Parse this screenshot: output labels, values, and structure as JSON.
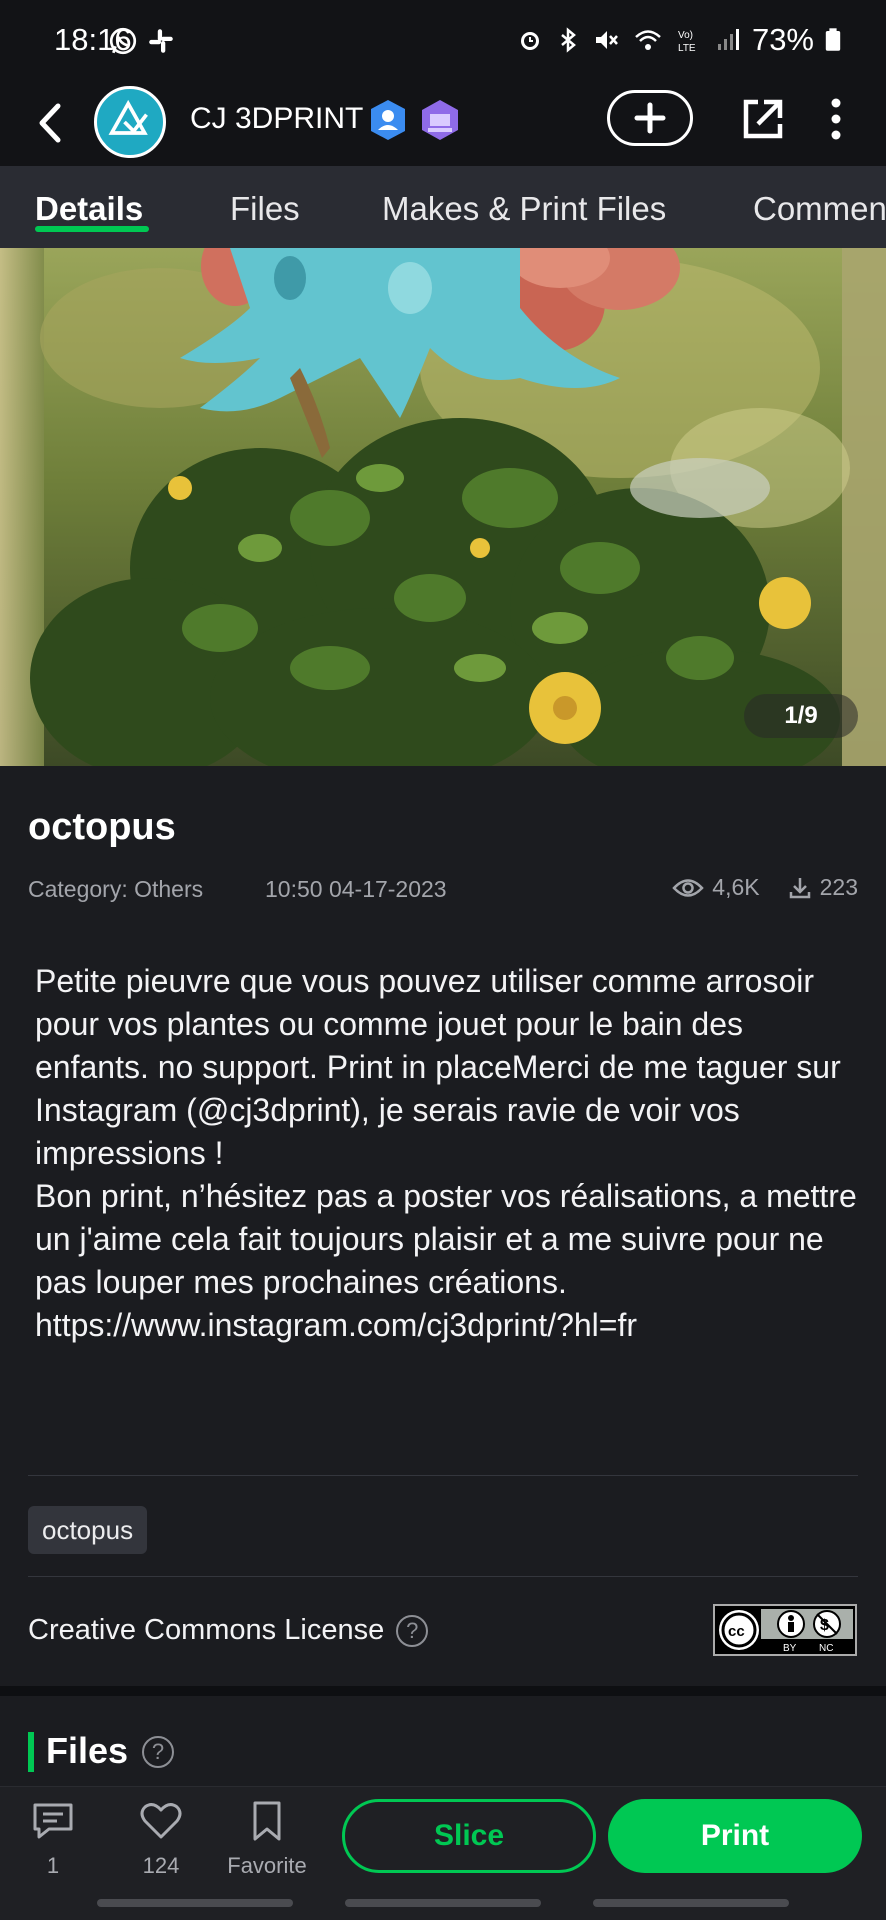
{
  "status_bar": {
    "time": "18:16",
    "battery": "73%",
    "icons_left": [
      "whatsapp-icon",
      "slack-icon"
    ],
    "icons_right": [
      "alarm-icon",
      "bluetooth-icon",
      "mute-icon",
      "wifi-icon",
      "volte-icon",
      "signal-icon",
      "battery-icon"
    ]
  },
  "header": {
    "author": "CJ 3DPRINT",
    "avatar_label": "3D PRINT"
  },
  "tabs": [
    "Details",
    "Files",
    "Makes & Print Files",
    "Commen"
  ],
  "gallery": {
    "counter": "1/9"
  },
  "model": {
    "title": "octopus",
    "category": "Category: Others",
    "timestamp": "10:50 04-17-2023",
    "views": "4,6K",
    "downloads": "223",
    "description": "Petite pieuvre que vous pouvez utiliser comme arrosoir pour vos plantes ou comme jouet pour le bain des enfants. no support. Print in placeMerci de me taguer sur Instagram (@cj3dprint), je serais ravie de voir vos impressions !\nBon print, n’hésitez pas a poster vos réalisations, a mettre un j'aime cela fait toujours plaisir et a me suivre pour ne pas louper mes prochaines créations.\nhttps://www.instagram.com/cj3dprint/?hl=fr",
    "tag": "octopus",
    "license_label": "Creative Commons License",
    "license_badge": [
      "BY",
      "NC"
    ]
  },
  "files_section": {
    "title": "Files"
  },
  "bottom_bar": {
    "comments_count": "1",
    "likes_count": "124",
    "favorite_label": "Favorite",
    "slice_label": "Slice",
    "print_label": "Print"
  },
  "colors": {
    "accent": "#00c853",
    "background": "#1b1c20",
    "header": "#121316",
    "tabbar": "#2a2c33"
  }
}
